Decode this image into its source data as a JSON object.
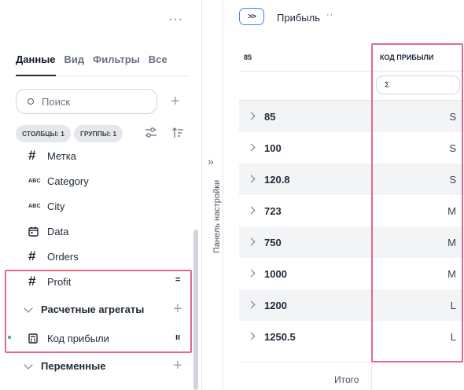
{
  "left_panel": {
    "more_label": "···",
    "tabs": [
      {
        "label": "Данные",
        "active": true
      },
      {
        "label": "Вид",
        "active": false
      },
      {
        "label": "Фильтры",
        "active": false
      },
      {
        "label": "Все",
        "active": false
      }
    ],
    "search": {
      "placeholder": "Поиск",
      "value": ""
    },
    "add_label": "+",
    "chips": {
      "columns": "СТОЛБЦЫ: 1",
      "groups": "ГРУППЫ: 1"
    },
    "fields": [
      {
        "label": "Метка",
        "type": "number",
        "icon": "#"
      },
      {
        "label": "Category",
        "type": "string",
        "icon": "ABC"
      },
      {
        "label": "City",
        "type": "string",
        "icon": "ABC"
      },
      {
        "label": "Data",
        "type": "date",
        "icon": "calendar-icon"
      },
      {
        "label": "Orders",
        "type": "number",
        "icon": "#"
      },
      {
        "label": "Profit",
        "type": "number",
        "icon": "#",
        "mark": "="
      }
    ],
    "groups": {
      "calculated": {
        "label": "Расчетные агрегаты",
        "add": "+"
      },
      "variables": {
        "label": "Переменные",
        "add": "+"
      }
    },
    "calc_item": {
      "label": "Код прибыли",
      "mark": "ıı"
    },
    "highlight_color": "#e4698f",
    "accent_dot_color": "#4fb6b8"
  },
  "settings_strip": {
    "arrows": "»",
    "label": "Панель настройки"
  },
  "table": {
    "expand_button": ">>",
    "title": "Прибыль",
    "title_more": "··",
    "columns": [
      "85",
      "КОД ПРИБЫЛИ"
    ],
    "formula_symbol": "Σ",
    "rows": [
      {
        "value": "85",
        "code": "S"
      },
      {
        "value": "100",
        "code": "S"
      },
      {
        "value": "120.8",
        "code": "S"
      },
      {
        "value": "723",
        "code": "M"
      },
      {
        "value": "750",
        "code": "M"
      },
      {
        "value": "1000",
        "code": "M"
      },
      {
        "value": "1200",
        "code": "L"
      },
      {
        "value": "1250.5",
        "code": "L"
      }
    ],
    "total_label": "Итого",
    "accent_color": "#3b82f6",
    "highlight_color": "#e4698f"
  }
}
